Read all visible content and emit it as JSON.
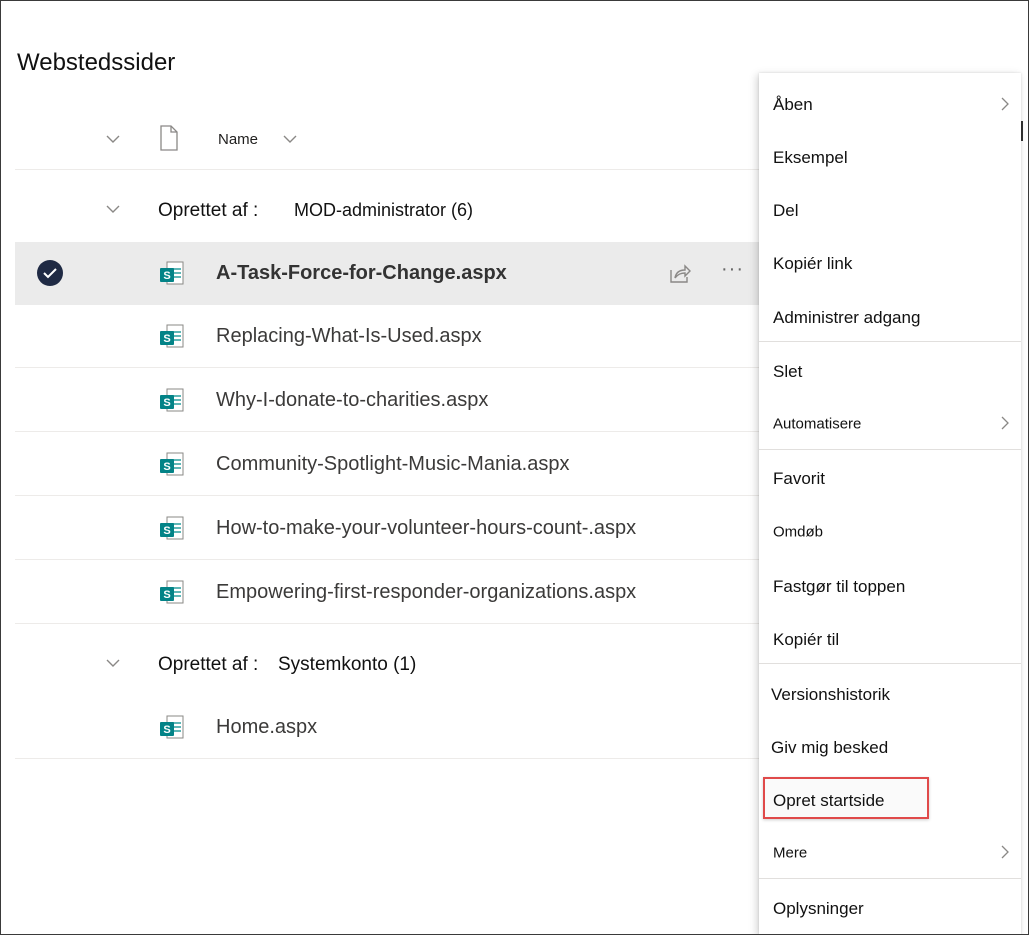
{
  "page": {
    "title": "Webstedssider"
  },
  "list_header": {
    "name_column": "Name"
  },
  "groups": [
    {
      "label": "Oprettet af :",
      "value": "MOD-administrator (6)",
      "files": [
        {
          "name": "A-Task-Force-for-Change.aspx",
          "selected": true
        },
        {
          "name": "Replacing-What-Is-Used.aspx"
        },
        {
          "name": "Why-I-donate-to-charities.aspx"
        },
        {
          "name": "Community-Spotlight-Music-Mania.aspx"
        },
        {
          "name": "How-to-make-your-volunteer-hours-count-.aspx"
        },
        {
          "name": "Empowering-first-responder-organizations.aspx"
        }
      ]
    },
    {
      "label": "Oprettet af :",
      "value": "Systemkonto (1)",
      "files": [
        {
          "name": "Home.aspx"
        }
      ]
    }
  ],
  "context_menu": {
    "items": [
      {
        "label": "Åben",
        "submenu": true
      },
      {
        "label": "Eksempel"
      },
      {
        "label": "Del"
      },
      {
        "label": "Kopiér link"
      },
      {
        "label": "Administrer adgang"
      },
      {
        "label": "Slet"
      },
      {
        "label": "Automatisere",
        "submenu": true
      },
      {
        "label": "Favorit"
      },
      {
        "label": "Omdøb"
      },
      {
        "label": "Fastgør til toppen"
      },
      {
        "label": "Kopiér til"
      },
      {
        "label": "Versionshistorik"
      },
      {
        "label": "Giv mig besked"
      },
      {
        "label": "Opret startside",
        "highlighted": true
      },
      {
        "label": "Mere",
        "submenu": true
      },
      {
        "label": "Oplysninger"
      }
    ]
  },
  "colors": {
    "sharepoint_teal": "#038387",
    "selected_row": "#ebebeb",
    "highlight_red": "#e04a4a",
    "check_navy": "#1f2a44"
  }
}
